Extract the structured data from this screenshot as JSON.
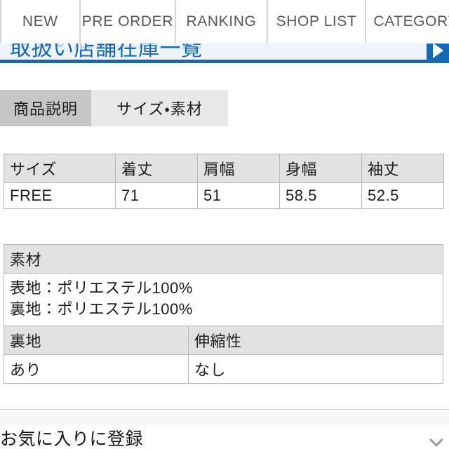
{
  "global_nav": {
    "items": [
      {
        "label": "NEW",
        "name": "nav-item-new"
      },
      {
        "label": "PRE ORDER",
        "name": "nav-item-pre-order"
      },
      {
        "label": "RANKING",
        "name": "nav-item-ranking"
      },
      {
        "label": "SHOP LIST",
        "name": "nav-item-shop-list"
      },
      {
        "label": "CATEGORY",
        "name": "nav-item-category"
      }
    ]
  },
  "promo_banner": {
    "title": "取扱い店舗在庫一覧",
    "ghost_title": "取扱い店舗在庫一覧",
    "arrow_icon": "play-triangle-right-icon",
    "background_color": "#eef4fb",
    "accent_color": "#1569b4"
  },
  "detail_tabs": [
    {
      "label": "商品説明",
      "state": "inactive",
      "background_color": "#c6c6c6"
    },
    {
      "label": "サイズ・素材",
      "state": "active",
      "background_color": "#e8e8e8"
    }
  ],
  "size_table": {
    "headers": [
      "サイズ",
      "着丈",
      "肩幅",
      "身幅",
      "袖丈"
    ],
    "rows": [
      [
        "FREE",
        "71",
        "51",
        "58.5",
        "52.5"
      ]
    ]
  },
  "material_table": {
    "header": "素材",
    "composition_lines": [
      "表地：ポリエステル100%",
      "裏地：ポリエステル100%"
    ],
    "attribute_headers": [
      "裏地",
      "伸縮性"
    ],
    "attribute_values": [
      "あり",
      "なし"
    ]
  },
  "footer": {
    "favorite_label": "お気に入りに登録",
    "chevron_icon": "chevron-down-icon"
  }
}
